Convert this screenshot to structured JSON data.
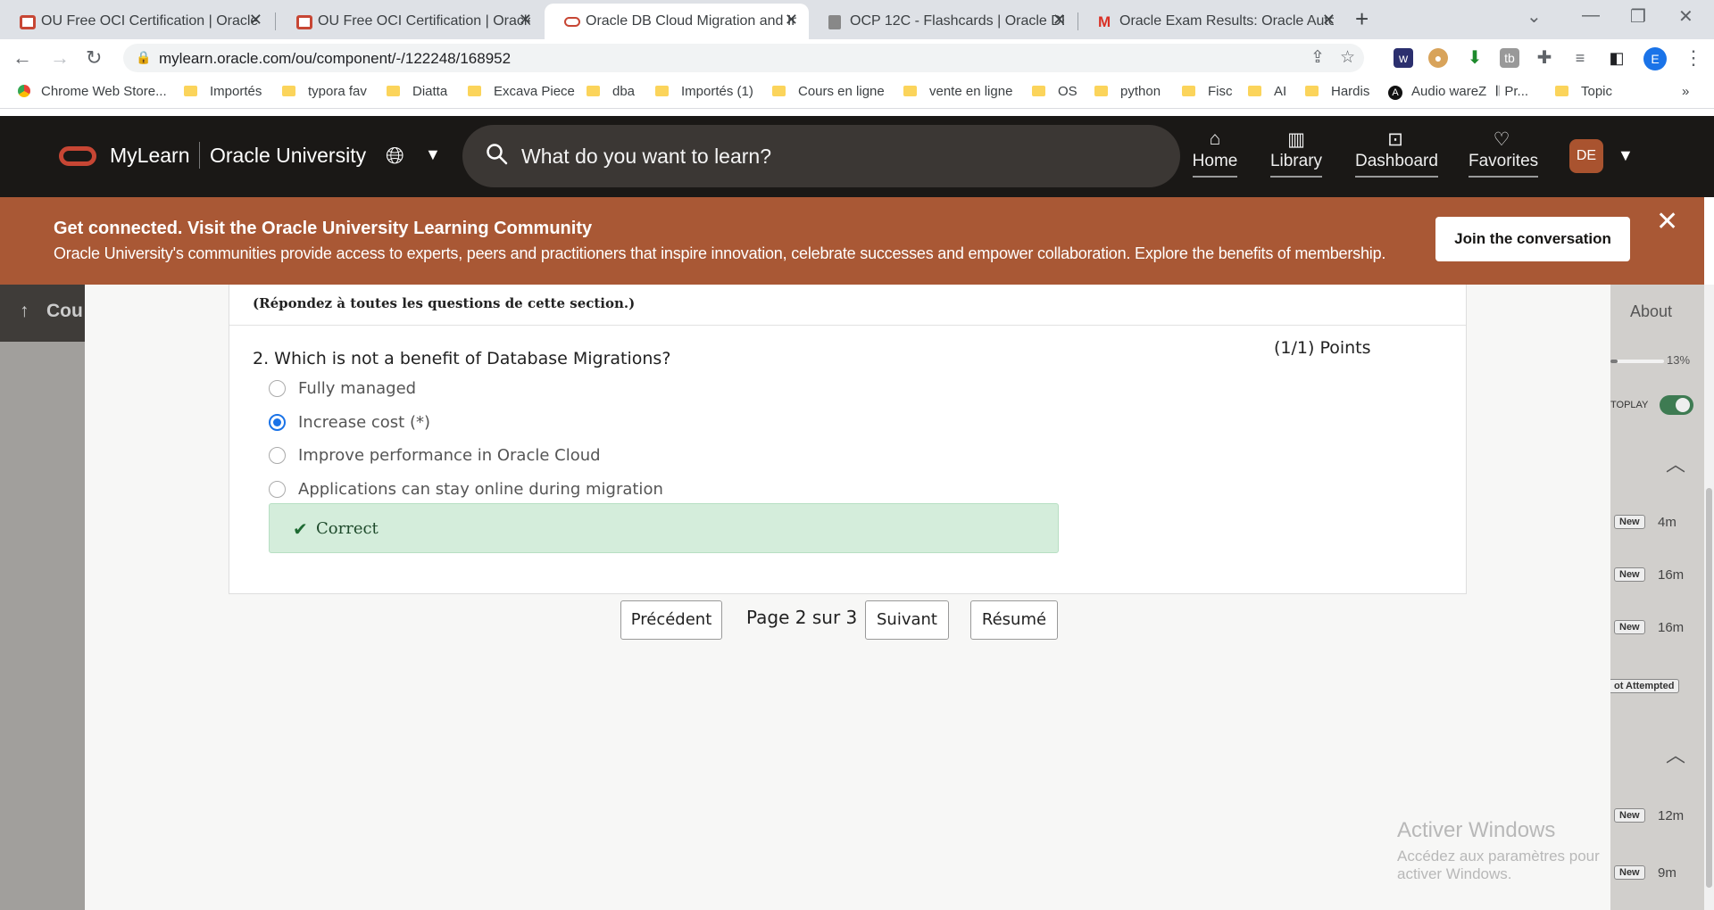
{
  "browser": {
    "tabs": [
      {
        "title": "OU Free OCI Certification | Oracle",
        "favicon": "oracle-icon"
      },
      {
        "title": "OU Free OCI Certification | Oracle",
        "favicon": "oracle-icon"
      },
      {
        "title": "Oracle DB Cloud Migration and In",
        "favicon": "oracle-outline-icon",
        "active": true
      },
      {
        "title": "OCP 12C - Flashcards | Oracle DB",
        "favicon": "document-icon"
      },
      {
        "title": "Oracle Exam Results: Oracle Auto",
        "favicon": "gmail-icon"
      }
    ],
    "url": "mylearn.oracle.com/ou/component/-/122248/168952",
    "profile_initial": "E",
    "bookmarks": [
      "Chrome Web Store...",
      "Importés",
      "typora fav",
      "Diatta",
      "Excava Piece",
      "dba",
      "Importés (1)",
      "Cours en ligne",
      "vente en ligne",
      "OS",
      "python",
      "Fisc",
      "AI",
      "Hardis",
      "Audio wareZ",
      "Pr...",
      "Topic"
    ],
    "bookmarks_more": "»"
  },
  "header": {
    "brand": "MyLearn",
    "subbrand": "Oracle University",
    "search_placeholder": "What do you want to learn?",
    "nav": [
      {
        "label": "Home",
        "icon": "home-icon"
      },
      {
        "label": "Library",
        "icon": "library-icon"
      },
      {
        "label": "Dashboard",
        "icon": "dashboard-icon"
      },
      {
        "label": "Favorites",
        "icon": "heart-icon"
      }
    ],
    "avatar": "DE"
  },
  "banner": {
    "title": "Get connected. Visit the Oracle University Learning Community",
    "text": "Oracle University's communities provide access to experts, peers and practitioners that inspire innovation, celebrate successes and empower collaboration. Explore the benefits of membership.",
    "button": "Join the conversation"
  },
  "left": {
    "label": "Cou"
  },
  "right": {
    "about": "About",
    "progress": "13%",
    "progress_value": 0.13,
    "autoplay": "TOPLAY",
    "items": [
      {
        "badge": "New",
        "time": "4m"
      },
      {
        "badge": "New",
        "time": "16m"
      },
      {
        "badge": "New",
        "time": "16m"
      }
    ],
    "not_attempted": "ot Attempted",
    "items2": [
      {
        "badge": "New",
        "time": "12m"
      },
      {
        "badge": "New",
        "time": "9m"
      }
    ]
  },
  "quiz": {
    "instruction": "(Répondez à toutes les questions de cette section.)",
    "question": "2. Which is not a benefit of Database Migrations?",
    "points": "(1/1) Points",
    "options": [
      {
        "label": "Fully managed",
        "selected": false
      },
      {
        "label": "Increase cost (*)",
        "selected": true
      },
      {
        "label": "Improve performance in Oracle Cloud",
        "selected": false
      },
      {
        "label": "Applications can stay online during migration",
        "selected": false
      }
    ],
    "feedback": "Correct"
  },
  "pager": {
    "prev": "Précédent",
    "page": "Page 2 sur 3",
    "next": "Suivant",
    "summary": "Résumé"
  },
  "watermark": {
    "line1": "Activer Windows",
    "line2": "Accédez aux paramètres pour activer Windows."
  }
}
